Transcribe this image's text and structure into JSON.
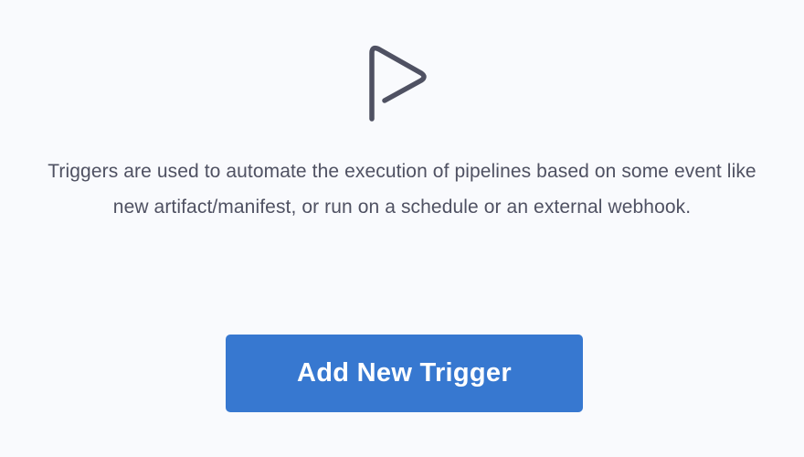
{
  "empty_state": {
    "icon": "play-icon",
    "description": "Triggers are used to automate the execution of pipelines based on some event like new artifact/manifest, or run on a schedule or an external webhook.",
    "add_button_label": "Add New Trigger"
  },
  "colors": {
    "background": "#f9fafd",
    "icon_stroke": "#4f5162",
    "text": "#4f5162",
    "button_bg": "#3778d0",
    "button_text": "#ffffff"
  }
}
